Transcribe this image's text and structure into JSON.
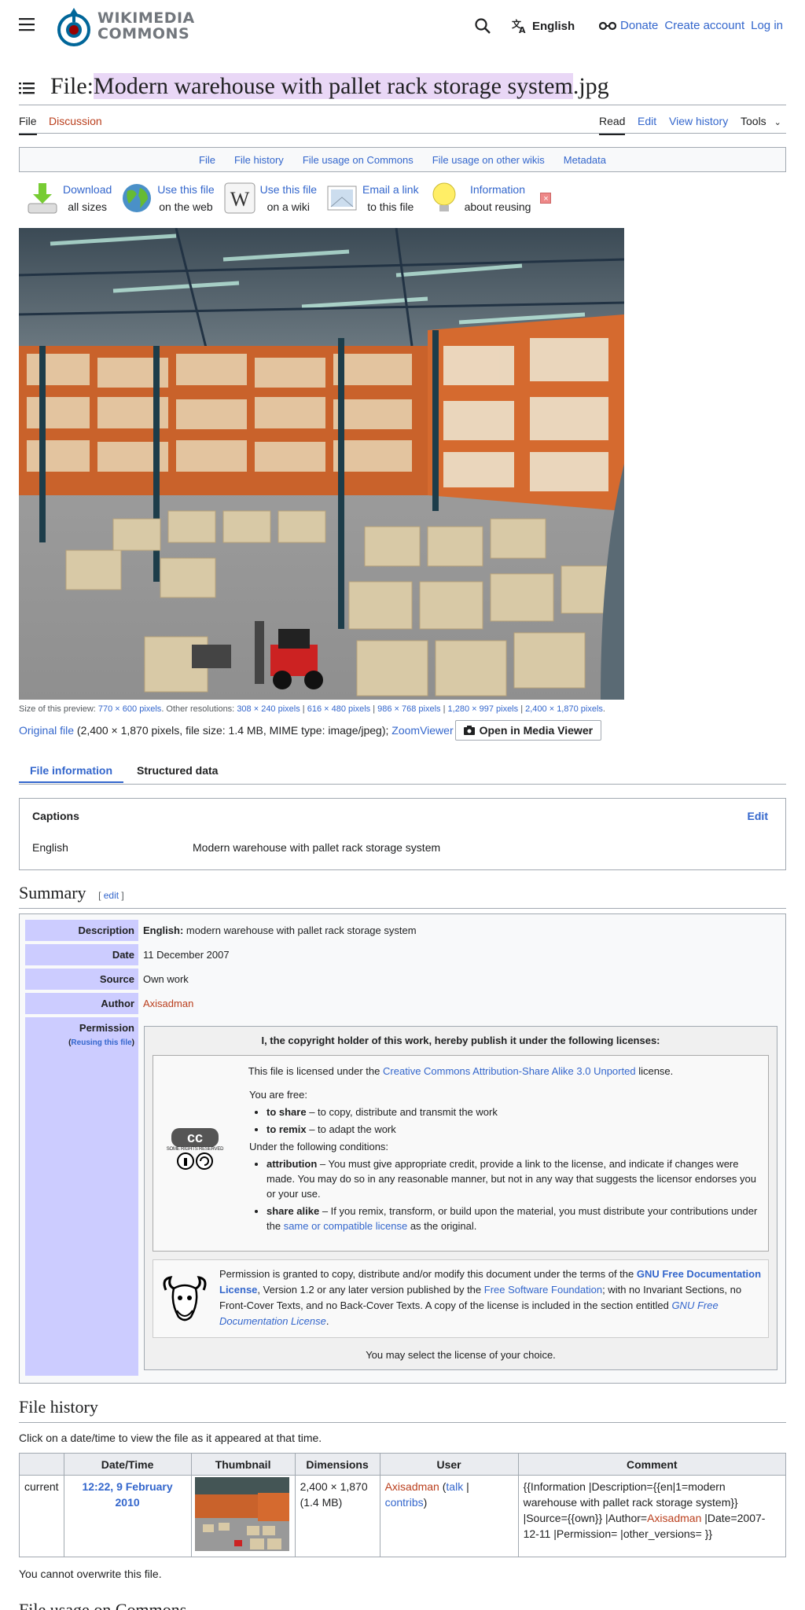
{
  "header": {
    "logo_line1": "WIKIMEDIA",
    "logo_line2": "COMMONS",
    "language": "English",
    "links": {
      "donate": "Donate",
      "create_account": "Create account",
      "login": "Log in"
    }
  },
  "title": {
    "prefix": "File:",
    "name": "Modern warehouse with pallet rack storage system",
    "ext": ".jpg"
  },
  "tabs": {
    "file": "File",
    "discussion": "Discussion",
    "read": "Read",
    "edit": "Edit",
    "history": "View history",
    "tools": "Tools"
  },
  "file_toc": [
    "File",
    "File history",
    "File usage on Commons",
    "File usage on other wikis",
    "Metadata"
  ],
  "reuse": [
    {
      "l1": "Download",
      "l2": "all sizes"
    },
    {
      "l1": "Use this file",
      "l2": "on the web"
    },
    {
      "l1": "Use this file",
      "l2": "on a wiki"
    },
    {
      "l1": "Email a link",
      "l2": "to this file"
    },
    {
      "l1": "Information",
      "l2": "about reusing"
    }
  ],
  "preview": {
    "label": "Size of this preview:",
    "current": "770 × 600 pixels",
    "other_label": ". Other resolutions:",
    "others": [
      "308 × 240 pixels",
      "616 × 480 pixels",
      "986 × 768 pixels",
      "1,280 × 997 pixels",
      "2,400 × 1,870 pixels"
    ],
    "original_link": "Original file",
    "original_info": "(2,400 × 1,870 pixels, file size: 1.4 MB, MIME type: image/jpeg);",
    "zoomviewer": "ZoomViewer",
    "media_viewer_btn": "Open in Media Viewer"
  },
  "info_tabs": {
    "file_info": "File information",
    "structured": "Structured data"
  },
  "captions": {
    "heading": "Captions",
    "edit": "Edit",
    "lang": "English",
    "text": "Modern warehouse with pallet rack storage system"
  },
  "summary": {
    "heading": "Summary",
    "edit": "edit",
    "rows": {
      "description_label": "Description",
      "description_lang": "English:",
      "description": "modern warehouse with pallet rack storage system",
      "date_label": "Date",
      "date": "11 December 2007",
      "source_label": "Source",
      "source": "Own work",
      "author_label": "Author",
      "author": "Axisadman",
      "permission_label": "Permission",
      "reusing": "Reusing this file"
    },
    "license": {
      "header": "I, the copyright holder of this work, hereby publish it under the following licenses:",
      "cc_intro": "This file is licensed under the",
      "cc_name": "Creative Commons Attribution-Share Alike 3.0 Unported",
      "cc_suffix": "license.",
      "free": "You are free:",
      "share_b": "to share",
      "share_t": " – to copy, distribute and transmit the work",
      "remix_b": "to remix",
      "remix_t": " – to adapt the work",
      "conditions": "Under the following conditions:",
      "attr_b": "attribution",
      "attr_t": " – You must give appropriate credit, provide a link to the license, and indicate if changes were made. You may do so in any reasonable manner, but not in any way that suggests the licensor endorses you or your use.",
      "sa_b": "share alike",
      "sa_t1": " – If you remix, transform, or build upon the material, you must distribute your contributions under the ",
      "sa_link": "same or compatible license",
      "sa_t2": " as the original.",
      "cc_badge": "SOME RIGHTS RESERVED",
      "gfdl_t1": "Permission is granted to copy, distribute and/or modify this document under the terms of the ",
      "gfdl_link": "GNU Free Documentation License",
      "gfdl_t2": ", Version 1.2 or any later version published by the ",
      "fsf": "Free Software Foundation",
      "gfdl_t3": "; with no Invariant Sections, no Front-Cover Texts, and no Back-Cover Texts. A copy of the license is included in the section entitled ",
      "gfdl_italic": "GNU Free Documentation License",
      "choice": "You may select the license of your choice."
    }
  },
  "history": {
    "heading": "File history",
    "intro": "Click on a date/time to view the file as it appeared at that time.",
    "cols": [
      "",
      "Date/Time",
      "Thumbnail",
      "Dimensions",
      "User",
      "Comment"
    ],
    "row": {
      "status": "current",
      "datetime": "12:22, 9 February 2010",
      "dims": "2,400 × 1,870",
      "size": "(1.4 MB)",
      "user": "Axisadman",
      "talk": "talk",
      "contribs": "contribs",
      "comment1": "{{Information |Description={{en|1=modern warehouse with pallet rack storage system}} |Source={{own}} |Author=",
      "comment_user": "Axisadman",
      "comment2": " |Date=2007-12-11 |Permission= |other_versions= }}"
    },
    "no_overwrite": "You cannot overwrite this file."
  },
  "next_heading": "File usage on Commons",
  "colors": {
    "link": "#3366cc",
    "red_link": "#ba3f1d",
    "label_bg": "#ccccff",
    "highlight": "#e9d7f6"
  }
}
